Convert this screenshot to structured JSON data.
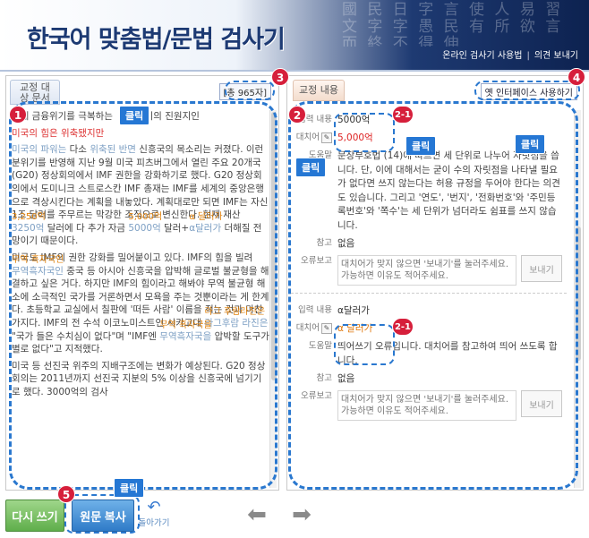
{
  "header": {
    "title": "한국어 맞춤법/문법 검사기",
    "bg_glyphs": "國 民 日 字 言 使 人 易 習 文 字 字 愚 民 有 所 欲 言 而 終 不 得 伸",
    "links": [
      "온라인 검사기 사용법",
      "의견 보내기"
    ]
  },
  "left_panel": {
    "tab_label": "교정 대상 문서",
    "count_label": "[총 965자]",
    "paragraphs": [
      {
        "segments": [
          {
            "text": "세계 금융위기를 극복하는 "
          },
          {
            "text": "클릭",
            "kind": "callout_text"
          },
          {
            "text": " 위기의 진원지인"
          }
        ]
      },
      {
        "segments": [
          {
            "text": "미국의 힘은",
            "kind": "red"
          },
          {
            "text": "    "
          },
          {
            "text": "위축됐지만",
            "kind": "red"
          }
        ]
      },
      {
        "segments": [
          {
            "text": "미국의 파워는",
            "kind": "blueish"
          },
          {
            "text": " 다소 "
          },
          {
            "text": "위축된 반면",
            "kind": "blueish"
          },
          {
            "text": " 신흥국의 목소리는 커졌다. 이런 분위기를 반영해 지난 9월 미국 피츠버그에서 열린 주요 20개국(G20) 정상회의에서 IMF 권한을 강화하기로 했다. G20 정상회의에서 도미니크 스트로스칸 IMF 총재는 IMF를 세계의 중앙은행으로 격상시킨다는 계획을 내놓았다. 계획대로만 되면 IMF는 자신 1조 달러를 주무르는 막강한 조직으로 변신한다. 현재 재산 "
          },
          {
            "text": "3250억",
            "kind": "blueish",
            "suggestion": "3,250억"
          },
          {
            "text": " 달러에 다 추가 자금 "
          },
          {
            "text": "5000억",
            "kind": "blueish",
            "suggestion": "5,000억"
          },
          {
            "text": " 달러+"
          },
          {
            "text": "α달러가",
            "kind": "blueish",
            "suggestion": "α 달러가"
          },
          {
            "text": " 더해질 전망이기 때문이다."
          }
        ]
      },
      {
        "segments": [
          {
            "text": "미국도 IMF의 권한 강화를 밀어붙이고 있다. IMF의 힘을 빌려 "
          },
          {
            "text": "무역흑자국인",
            "kind": "blueish",
            "suggestion": "무역 흑자국인"
          },
          {
            "text": " 중국 등 아시아 신흥국을 압박해 글로벌 불균형을 해결하고 싶은 거다. 하지만 IMF의 힘이라고 해봐야 무역 불균형 해소에 소극적인 국가를 거론하면서 모욕을 주는 것뿐이라는 게 한계다. 초등학교 교실에서 칠판에 '떠든 사람' 이름을 적는 것과 마찬가지다. IMF의 전 수석 이코노미스트인 시카고대 "
          },
          {
            "text": "라그후람 라진은",
            "kind": "blueish",
            "suggestion": "라그 후람라진은"
          },
          {
            "text": " \"국가 들은 수치심이 없다\"며 \"IMF엔 "
          },
          {
            "text": "무역흑자국을",
            "kind": "blueish",
            "suggestion": "무역 흑자국을"
          },
          {
            "text": " 압박할 도구가 별로 없다\"고 지적했다."
          }
        ]
      },
      {
        "segments": [
          {
            "text": "미국 등 선진국 위주의 지배구조에는 변화가 예상된다. G20 정상회의는 2011년까지 선진국 지분의 5% 이상을 신흥국에 넘기기로 했다. 3000억의 검사"
          }
        ]
      }
    ]
  },
  "right_panel": {
    "tab_label": "교정 내용",
    "old_ui_label": "옛 인터페이스 사용하기",
    "labels": {
      "input": "입력 내용",
      "replace": "대치어",
      "help": "도움말",
      "ref": "참고",
      "report": "오류보고"
    },
    "entries": [
      {
        "input": "5000억",
        "replace": "5,000억",
        "help": "문장부호법 (14)에 따르면 세 단위로 나누어 자릿점을 씁니다. 단, 이에 대해서는 굳이 수의 자릿점을 나타낼 필요가 없다면 쓰지 않는다는 허용 규정을 두어야 한다는 의견도 있습니다. 그리고 '연도', '번지', '전화번호'와 '주민등록번호'와 '쪽수'는 세 단위가 넘더라도 쉼표를 쓰지 않습니다.",
        "ref": "없음",
        "report_placeholder": "대치어가 맞지 않으면 '보내기'를 눌러주세요. 가능하면 이유도 적어주세요."
      },
      {
        "input": "α달러가",
        "replace": "α 달러가",
        "help": "띄어쓰기 오류입니다. 대치어를 참고하여 띄어 쓰도록 합니다.",
        "ref": "없음",
        "report_placeholder": "대치어가 맞지 않으면 '보내기'를 눌러주세요. 가능하면 이유도 적어주세요."
      }
    ],
    "send_label": "보내기"
  },
  "bottom": {
    "retry_label": "다시 쓰기",
    "copy_label": "원문 복사",
    "undo_label": "돌아가기",
    "prev_icon": "left-arrow-icon",
    "next_icon": "right-arrow-icon"
  },
  "overlays": {
    "click_label": "클릭",
    "badges": [
      "1",
      "2",
      "3",
      "4",
      "5",
      "2-1",
      "2-1"
    ]
  },
  "colors": {
    "accent_blue": "#2a78cf",
    "badge_red": "#d61f3b",
    "error_red": "#d33333",
    "suggestion_orange": "#e0820b",
    "green_button": "#5fae4b",
    "blue_button": "#2f7bc8"
  }
}
